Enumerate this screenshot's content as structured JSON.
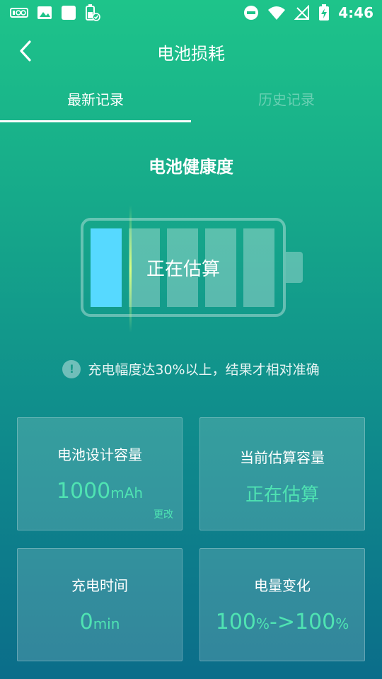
{
  "status_bar": {
    "time": "4:46",
    "icons_left": [
      "battery-saver-icon",
      "image-icon",
      "square-app-icon",
      "battery-check-icon"
    ],
    "icons_right": [
      "do-not-disturb-icon",
      "wifi-icon",
      "no-signal-icon",
      "battery-charging-icon"
    ]
  },
  "header": {
    "title": "电池损耗",
    "back_icon": "chevron-left-icon"
  },
  "tabs": [
    {
      "label": "最新记录",
      "selected": true
    },
    {
      "label": "历史记录",
      "selected": false
    }
  ],
  "section_title": "电池健康度",
  "battery": {
    "status_text": "正在估算",
    "cells_total": 5,
    "cells_active": 1,
    "active_color": "#56d9ff"
  },
  "notice": "充电幅度达30%以上，结果才相对准确",
  "cards": {
    "design_capacity": {
      "label": "电池设计容量",
      "value": "1000",
      "unit": "mAh",
      "edit_label": "更改"
    },
    "estimated_capacity": {
      "label": "当前估算容量",
      "value": "正在估算"
    },
    "charge_time": {
      "label": "充电时间",
      "value": "0",
      "unit": "min"
    },
    "level_change": {
      "label": "电量变化",
      "from": "100",
      "from_unit": "%",
      "arrow": "->",
      "to": "100",
      "to_unit": "%"
    }
  },
  "colors": {
    "accent": "#4fe3b2",
    "gradient_top": "#1ec48a",
    "gradient_bottom": "#0b6d8a"
  }
}
